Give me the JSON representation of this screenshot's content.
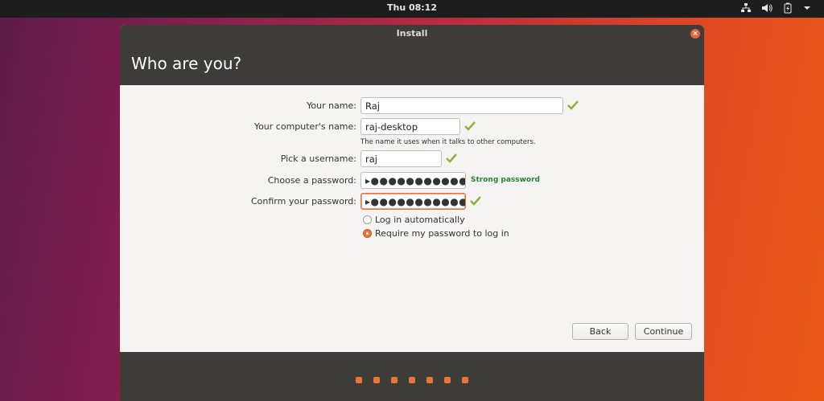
{
  "topbar": {
    "clock": "Thu 08:12",
    "tray_icons": [
      "network-icon",
      "volume-icon",
      "battery-icon",
      "menu-arrow-icon"
    ]
  },
  "window": {
    "title": "Install",
    "header": "Who are you?"
  },
  "form": {
    "name_label": "Your name:",
    "name_value": "Raj",
    "computer_label": "Your computer's name:",
    "computer_value": "raj-desktop",
    "computer_hint": "The name it uses when it talks to other computers.",
    "username_label": "Pick a username:",
    "username_value": "raj",
    "password_label": "Choose a password:",
    "password_value": "▸●●●●●●●●●●●●●",
    "password_strength": "Strong password",
    "confirm_label": "Confirm your password:",
    "confirm_value": "▸●●●●●●●●●●●●●",
    "login_auto_label": "Log in automatically",
    "login_require_label": "Require my password to log in",
    "login_selected": "require"
  },
  "buttons": {
    "back": "Back",
    "continue": "Continue"
  },
  "progress": {
    "total_steps": 7
  },
  "colors": {
    "accent": "#e8753e",
    "check_green": "#8cb23c",
    "strength_green": "#26803a",
    "dark_chrome": "#3d3c39"
  }
}
